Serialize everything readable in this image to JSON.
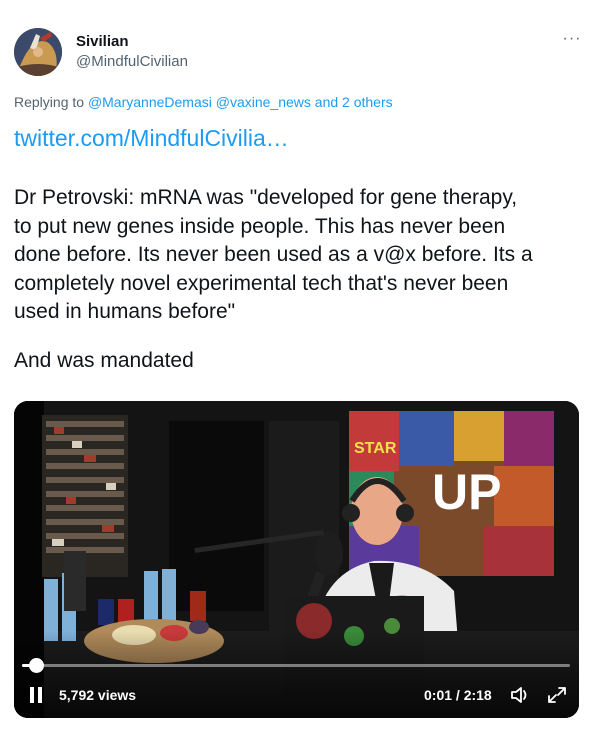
{
  "author": {
    "display_name": "Sivilian",
    "handle": "@MindfulCivilian"
  },
  "menu": {
    "more_label": "···"
  },
  "reply": {
    "prefix": "Replying to ",
    "mention_1": "@MaryanneDemasi",
    "mention_2": "@vaxine_news",
    "and_label": " and ",
    "others": "2 others",
    "space": " "
  },
  "link_text": "twitter.com/MindfulCivilia…",
  "tweet": {
    "lines": [
      "Dr Petrovski: mRNA was \"developed for gene therapy,",
      "to put new genes inside people. This has never been",
      "done before. Its never been used as a v@x before. Its a",
      "completely novel experimental tech that's never been",
      "used in humans before\""
    ],
    "second_paragraph": "And was mandated"
  },
  "video": {
    "views": "5,792 views",
    "time": "0:01 / 2:18",
    "progress_fraction": 0.02,
    "poster_sign": "UP",
    "poster_word": "STAR"
  },
  "colors": {
    "link": "#1d9bf0",
    "text": "#0f1419",
    "secondary": "#536471"
  },
  "icons": {
    "more": "more-dots-icon",
    "pause": "pause-icon",
    "volume": "volume-icon",
    "expand": "expand-icon"
  }
}
